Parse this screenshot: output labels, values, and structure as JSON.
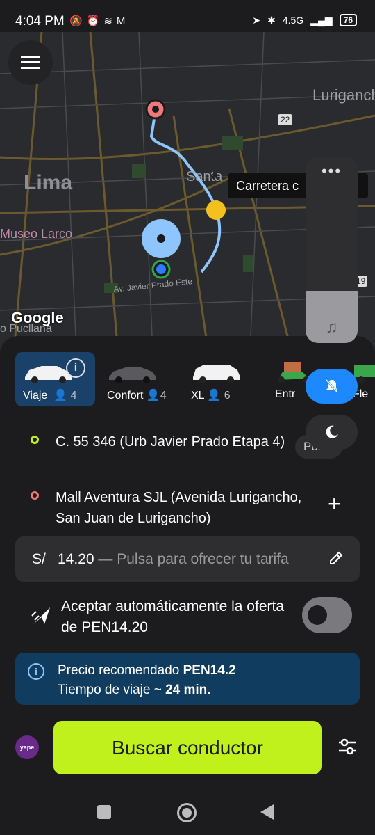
{
  "statusbar": {
    "time": "4:04 PM",
    "battery": "76",
    "network": "4.5G"
  },
  "map": {
    "labels": {
      "lurigancho": "Luriganch",
      "lima": "Lima",
      "santa": "Santa",
      "museo": "Museo Larco",
      "javier_prado": "Av. Javier Prado Este",
      "pucllana": "o Pucllana",
      "route_22": "22",
      "route_19": "19",
      "google": "Google",
      "poi_letter": "a"
    },
    "destination_tooltip": "Carretera c"
  },
  "services": [
    {
      "label": "Viaje",
      "count": "4",
      "active": true
    },
    {
      "label": "Confort",
      "count": "4",
      "active": false
    },
    {
      "label": "XL",
      "count": "6",
      "active": false
    },
    {
      "label": "Entr",
      "count": "",
      "active": false
    },
    {
      "label": "Fle",
      "count": "",
      "active": false
    }
  ],
  "route": {
    "origin": "C. 55 346 (Urb Javier Prado Etapa 4)",
    "destination": "Mall Aventura SJL (Avenida Lurigancho, San Juan de Lurigancho)",
    "portal_label": "Portal"
  },
  "fare": {
    "currency": "S/",
    "amount": "14.20",
    "hint": "— Pulsa para ofrecer tu tarifa"
  },
  "auto_accept": {
    "label": "Aceptar automáticamente la oferta de PEN14.20",
    "enabled": false
  },
  "recommendation": {
    "price_prefix": "Precio recomendado ",
    "price_value": "PEN14.2",
    "time_prefix": "Tiempo de viaje ~ ",
    "time_value": "24 min."
  },
  "payment": {
    "badge": "yape"
  },
  "cta": {
    "label": "Buscar conductor"
  },
  "colors": {
    "accent": "#c1f11d",
    "active_service": "#19416a",
    "info_banner": "#103c5f",
    "origin_pin": "#c1f11d",
    "destination_pin": "#f0787a",
    "route_line": "#8ec5ff"
  }
}
